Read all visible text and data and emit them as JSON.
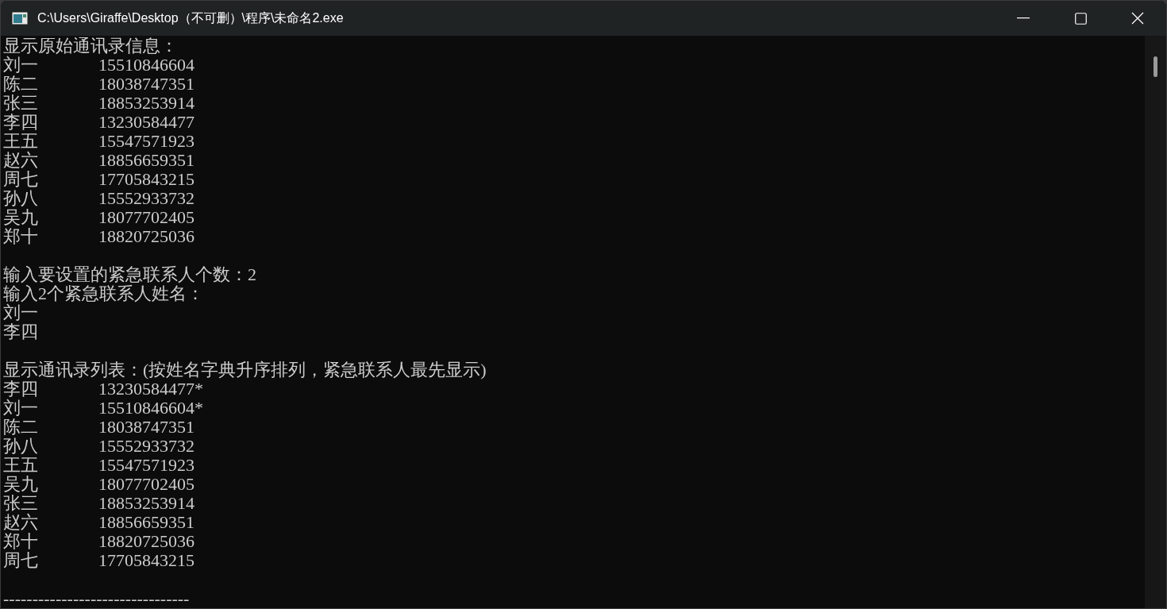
{
  "window": {
    "title": "C:\\Users\\Giraffe\\Desktop（不可删）\\程序\\未命名2.exe"
  },
  "console": {
    "lines": [
      {
        "kind": "text",
        "text": "显示原始通讯录信息："
      },
      {
        "kind": "entry",
        "name": "刘一",
        "phone": "15510846604"
      },
      {
        "kind": "entry",
        "name": "陈二",
        "phone": "18038747351"
      },
      {
        "kind": "entry",
        "name": "张三",
        "phone": "18853253914"
      },
      {
        "kind": "entry",
        "name": "李四",
        "phone": "13230584477"
      },
      {
        "kind": "entry",
        "name": "王五",
        "phone": "15547571923"
      },
      {
        "kind": "entry",
        "name": "赵六",
        "phone": "18856659351"
      },
      {
        "kind": "entry",
        "name": "周七",
        "phone": "17705843215"
      },
      {
        "kind": "entry",
        "name": "孙八",
        "phone": "15552933732"
      },
      {
        "kind": "entry",
        "name": "吴九",
        "phone": "18077702405"
      },
      {
        "kind": "entry",
        "name": "郑十",
        "phone": "18820725036"
      },
      {
        "kind": "blank"
      },
      {
        "kind": "text",
        "text": "输入要设置的紧急联系人个数：2"
      },
      {
        "kind": "text",
        "text": "输入2个紧急联系人姓名："
      },
      {
        "kind": "text",
        "text": "刘一"
      },
      {
        "kind": "text",
        "text": "李四"
      },
      {
        "kind": "blank"
      },
      {
        "kind": "text",
        "text": "显示通讯录列表：(按姓名字典升序排列，紧急联系人最先显示)"
      },
      {
        "kind": "entry",
        "name": "李四",
        "phone": "13230584477*"
      },
      {
        "kind": "entry",
        "name": "刘一",
        "phone": "15510846604*"
      },
      {
        "kind": "entry",
        "name": "陈二",
        "phone": "18038747351"
      },
      {
        "kind": "entry",
        "name": "孙八",
        "phone": "15552933732"
      },
      {
        "kind": "entry",
        "name": "王五",
        "phone": "15547571923"
      },
      {
        "kind": "entry",
        "name": "吴九",
        "phone": "18077702405"
      },
      {
        "kind": "entry",
        "name": "张三",
        "phone": "18853253914"
      },
      {
        "kind": "entry",
        "name": "赵六",
        "phone": "18856659351"
      },
      {
        "kind": "entry",
        "name": "郑十",
        "phone": "18820725036"
      },
      {
        "kind": "entry",
        "name": "周七",
        "phone": "17705843215"
      },
      {
        "kind": "blank"
      },
      {
        "kind": "text",
        "text": "--------------------------------"
      }
    ]
  }
}
